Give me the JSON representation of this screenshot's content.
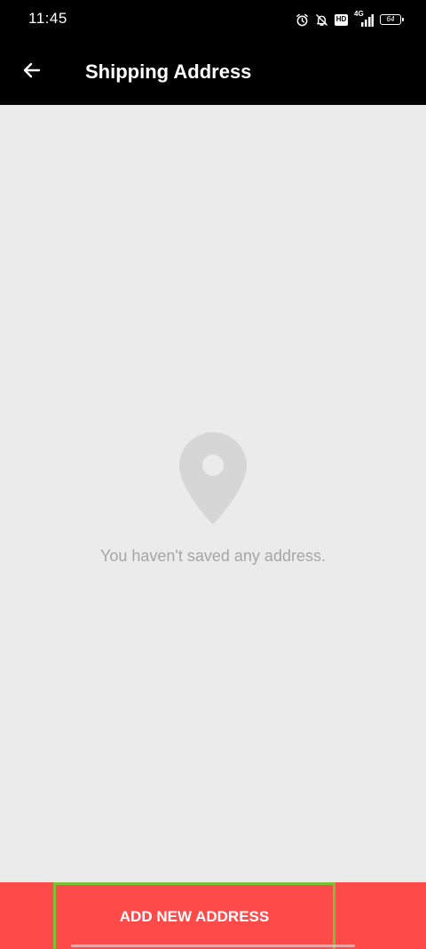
{
  "status_bar": {
    "time": "11:45",
    "icons": [
      "alarm-icon",
      "bell-off-icon",
      "hd-icon",
      "signal-4g-icon",
      "battery-icon"
    ],
    "hd_label": "HD",
    "network_label": "4G",
    "battery_level": "64"
  },
  "app_bar": {
    "title": "Shipping Address",
    "back_icon": "arrow-left-icon"
  },
  "empty_state": {
    "icon": "location-pin-icon",
    "message": "You haven't saved any address."
  },
  "footer": {
    "add_button_label": "ADD NEW ADDRESS"
  },
  "colors": {
    "app_bar": "#000000",
    "background": "#ebebeb",
    "button": "#ff4a4a",
    "highlight_border": "#7cc035",
    "muted_text": "#a6a6a6",
    "pin": "#d6d6d6"
  }
}
